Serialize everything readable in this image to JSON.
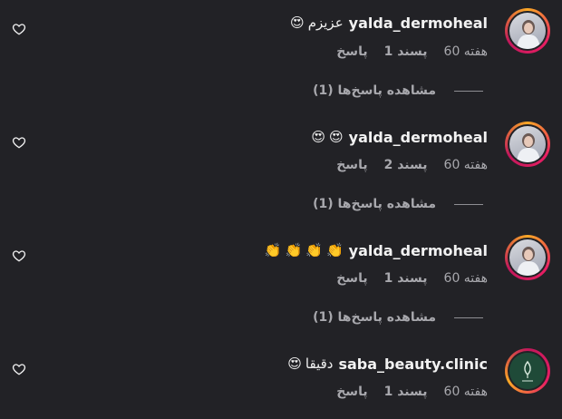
{
  "comments": [
    {
      "username": "yalda_dermoheal",
      "text": "عزیزم",
      "emojis": [
        "😍"
      ],
      "time": "60 هفته",
      "likes": "1 پسند",
      "reply": "پاسخ",
      "view_replies": "مشاهده پاسخ‌ها (1)"
    },
    {
      "username": "yalda_dermoheal",
      "text": "",
      "emojis": [
        "😍",
        "😍"
      ],
      "time": "60 هفته",
      "likes": "2 پسند",
      "reply": "پاسخ",
      "view_replies": "مشاهده پاسخ‌ها (1)"
    },
    {
      "username": "yalda_dermoheal",
      "text": "",
      "emojis": [
        "👏",
        "👏",
        "👏",
        "👏"
      ],
      "time": "60 هفته",
      "likes": "1 پسند",
      "reply": "پاسخ",
      "view_replies": "مشاهده پاسخ‌ها (1)"
    },
    {
      "username": "saba_beauty.clinic",
      "text": "دقیقا",
      "emojis": [
        "😍"
      ],
      "time": "60 هفته",
      "likes": "1 پسند",
      "reply": "پاسخ"
    }
  ]
}
